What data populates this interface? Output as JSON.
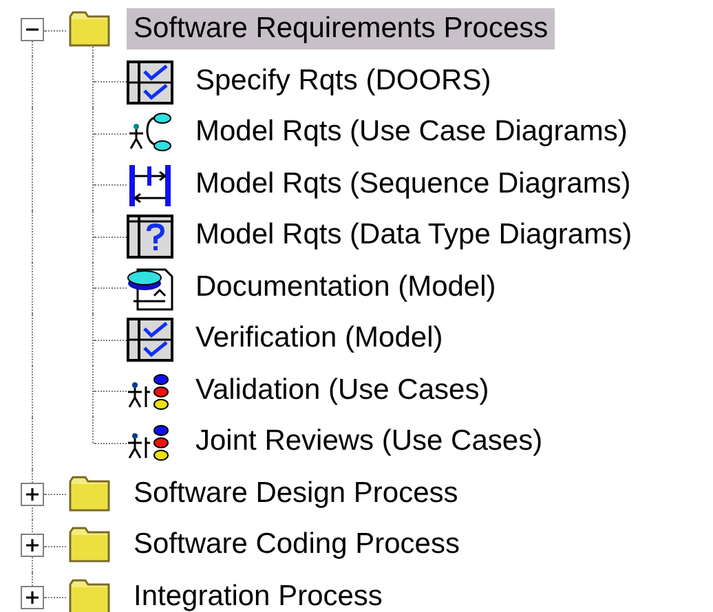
{
  "tree": [
    {
      "label": "Software Requirements Process",
      "expanded": true,
      "selected": true,
      "children": [
        {
          "label": "Specify Rqts (DOORS)",
          "kind": "checklist"
        },
        {
          "label": "Model Rqts (Use Case Diagrams)",
          "kind": "usecase"
        },
        {
          "label": "Model Rqts (Sequence Diagrams)",
          "kind": "sequence"
        },
        {
          "label": "Model Rqts (Data Type Diagrams)",
          "kind": "datatype"
        },
        {
          "label": "Documentation (Model)",
          "kind": "document"
        },
        {
          "label": "Verification (Model)",
          "kind": "checklist"
        },
        {
          "label": "Validation (Use Cases)",
          "kind": "actors"
        },
        {
          "label": "Joint Reviews (Use Cases)",
          "kind": "actors"
        }
      ]
    },
    {
      "label": "Software Design Process",
      "expanded": false,
      "selected": false
    },
    {
      "label": "Software Coding Process",
      "expanded": false,
      "selected": false
    },
    {
      "label": "Integration Process",
      "expanded": false,
      "selected": false
    }
  ]
}
